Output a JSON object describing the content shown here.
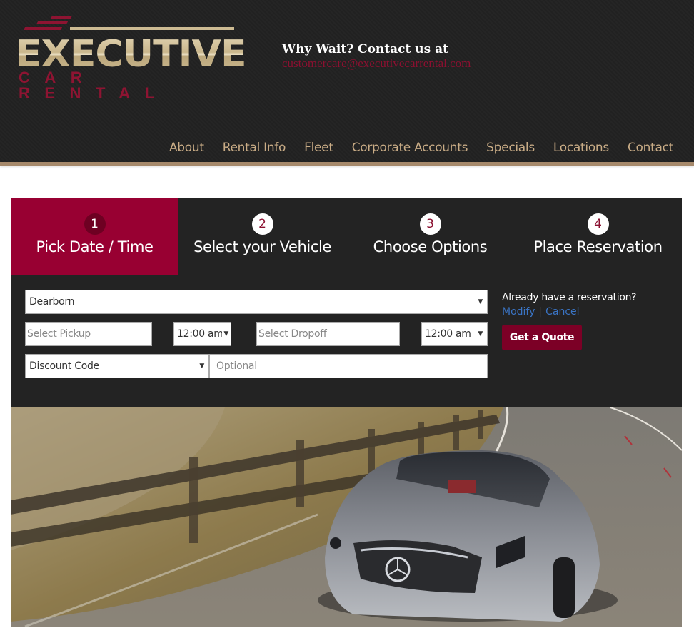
{
  "brand": {
    "logo_main": "EXECUTIVE",
    "logo_sub": "CAR RENTAL"
  },
  "contact": {
    "title": "Why Wait? Contact us at",
    "email": "customercare@executivecarrental.com"
  },
  "nav": {
    "items": [
      {
        "label": "About"
      },
      {
        "label": "Rental Info"
      },
      {
        "label": "Fleet"
      },
      {
        "label": "Corporate Accounts"
      },
      {
        "label": "Specials"
      },
      {
        "label": "Locations"
      },
      {
        "label": "Contact"
      }
    ]
  },
  "steps": [
    {
      "number": "1",
      "label": "Pick Date / Time",
      "active": true
    },
    {
      "number": "2",
      "label": "Select your Vehicle",
      "active": false
    },
    {
      "number": "3",
      "label": "Choose Options",
      "active": false
    },
    {
      "number": "4",
      "label": "Place Reservation",
      "active": false
    }
  ],
  "form": {
    "location_value": "Dearborn",
    "pickup_placeholder": "Select Pickup",
    "pickup_time": "12:00 am",
    "dropoff_placeholder": "Select Dropoff",
    "dropoff_time": "12:00 am",
    "discount_select": "Discount Code",
    "discount_placeholder": "Optional"
  },
  "reservation": {
    "question": "Already have a reservation?",
    "modify_label": "Modify",
    "cancel_label": "Cancel",
    "quote_button": "Get a Quote"
  },
  "colors": {
    "brand_red": "#980032",
    "nav_gold": "#c9ac86",
    "header_bg": "#212121",
    "link_blue": "#3a74c4"
  },
  "hero": {
    "image_subject": "silver sports car driving on coastal road"
  }
}
